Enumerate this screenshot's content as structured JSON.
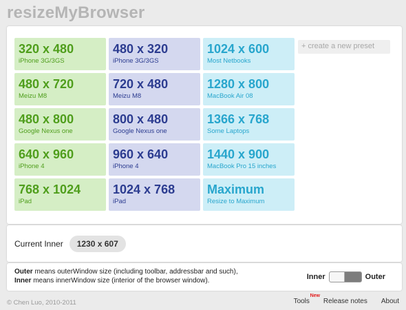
{
  "header": {
    "title": "resizeMyBrowser"
  },
  "presets": [
    {
      "size": "320 x 480",
      "device": "iPhone 3G/3GS",
      "color": "green",
      "name": "preset-320x480"
    },
    {
      "size": "480 x 320",
      "device": "iPhone 3G/3GS",
      "color": "blue",
      "name": "preset-480x320"
    },
    {
      "size": "1024 x 600",
      "device": "Most Netbooks",
      "color": "cyan",
      "name": "preset-1024x600"
    },
    {
      "size": "480 x 720",
      "device": "Meizu M8",
      "color": "green",
      "name": "preset-480x720"
    },
    {
      "size": "720 x 480",
      "device": "Meizu M8",
      "color": "blue",
      "name": "preset-720x480"
    },
    {
      "size": "1280 x 800",
      "device": "MacBook Air 08",
      "color": "cyan",
      "name": "preset-1280x800"
    },
    {
      "size": "480 x 800",
      "device": "Google Nexus one",
      "color": "green",
      "name": "preset-480x800"
    },
    {
      "size": "800 x 480",
      "device": "Google Nexus one",
      "color": "blue",
      "name": "preset-800x480"
    },
    {
      "size": "1366 x 768",
      "device": "Some Laptops",
      "color": "cyan",
      "name": "preset-1366x768"
    },
    {
      "size": "640 x 960",
      "device": "iPhone 4",
      "color": "green",
      "name": "preset-640x960"
    },
    {
      "size": "960 x 640",
      "device": "iPhone 4",
      "color": "blue",
      "name": "preset-960x640"
    },
    {
      "size": "1440 x 900",
      "device": "MacBook Pro 15 inches",
      "color": "cyan",
      "name": "preset-1440x900"
    },
    {
      "size": "768 x 1024",
      "device": "iPad",
      "color": "green",
      "name": "preset-768x1024"
    },
    {
      "size": "1024 x 768",
      "device": "iPad",
      "color": "blue",
      "name": "preset-1024x768"
    },
    {
      "size": "Maximum",
      "device": "Resize to Maximum",
      "color": "cyan",
      "name": "preset-maximum"
    }
  ],
  "create_preset": {
    "label": "+ create a new preset"
  },
  "current": {
    "label": "Current Inner",
    "value": "1230 x 607"
  },
  "legend": {
    "outer_term": "Outer",
    "outer_desc": " means outerWindow size (including toolbar, addressbar and such),",
    "inner_term": "Inner",
    "inner_desc": " means innerWindow size (interior of the browser window)."
  },
  "toggle": {
    "left_label": "Inner",
    "right_label": "Outer"
  },
  "footer": {
    "copyright": "© Chen Luo, 2010-2011",
    "links": {
      "tools": "Tools",
      "new_badge": "New",
      "release_notes": "Release notes",
      "about": "About"
    }
  }
}
